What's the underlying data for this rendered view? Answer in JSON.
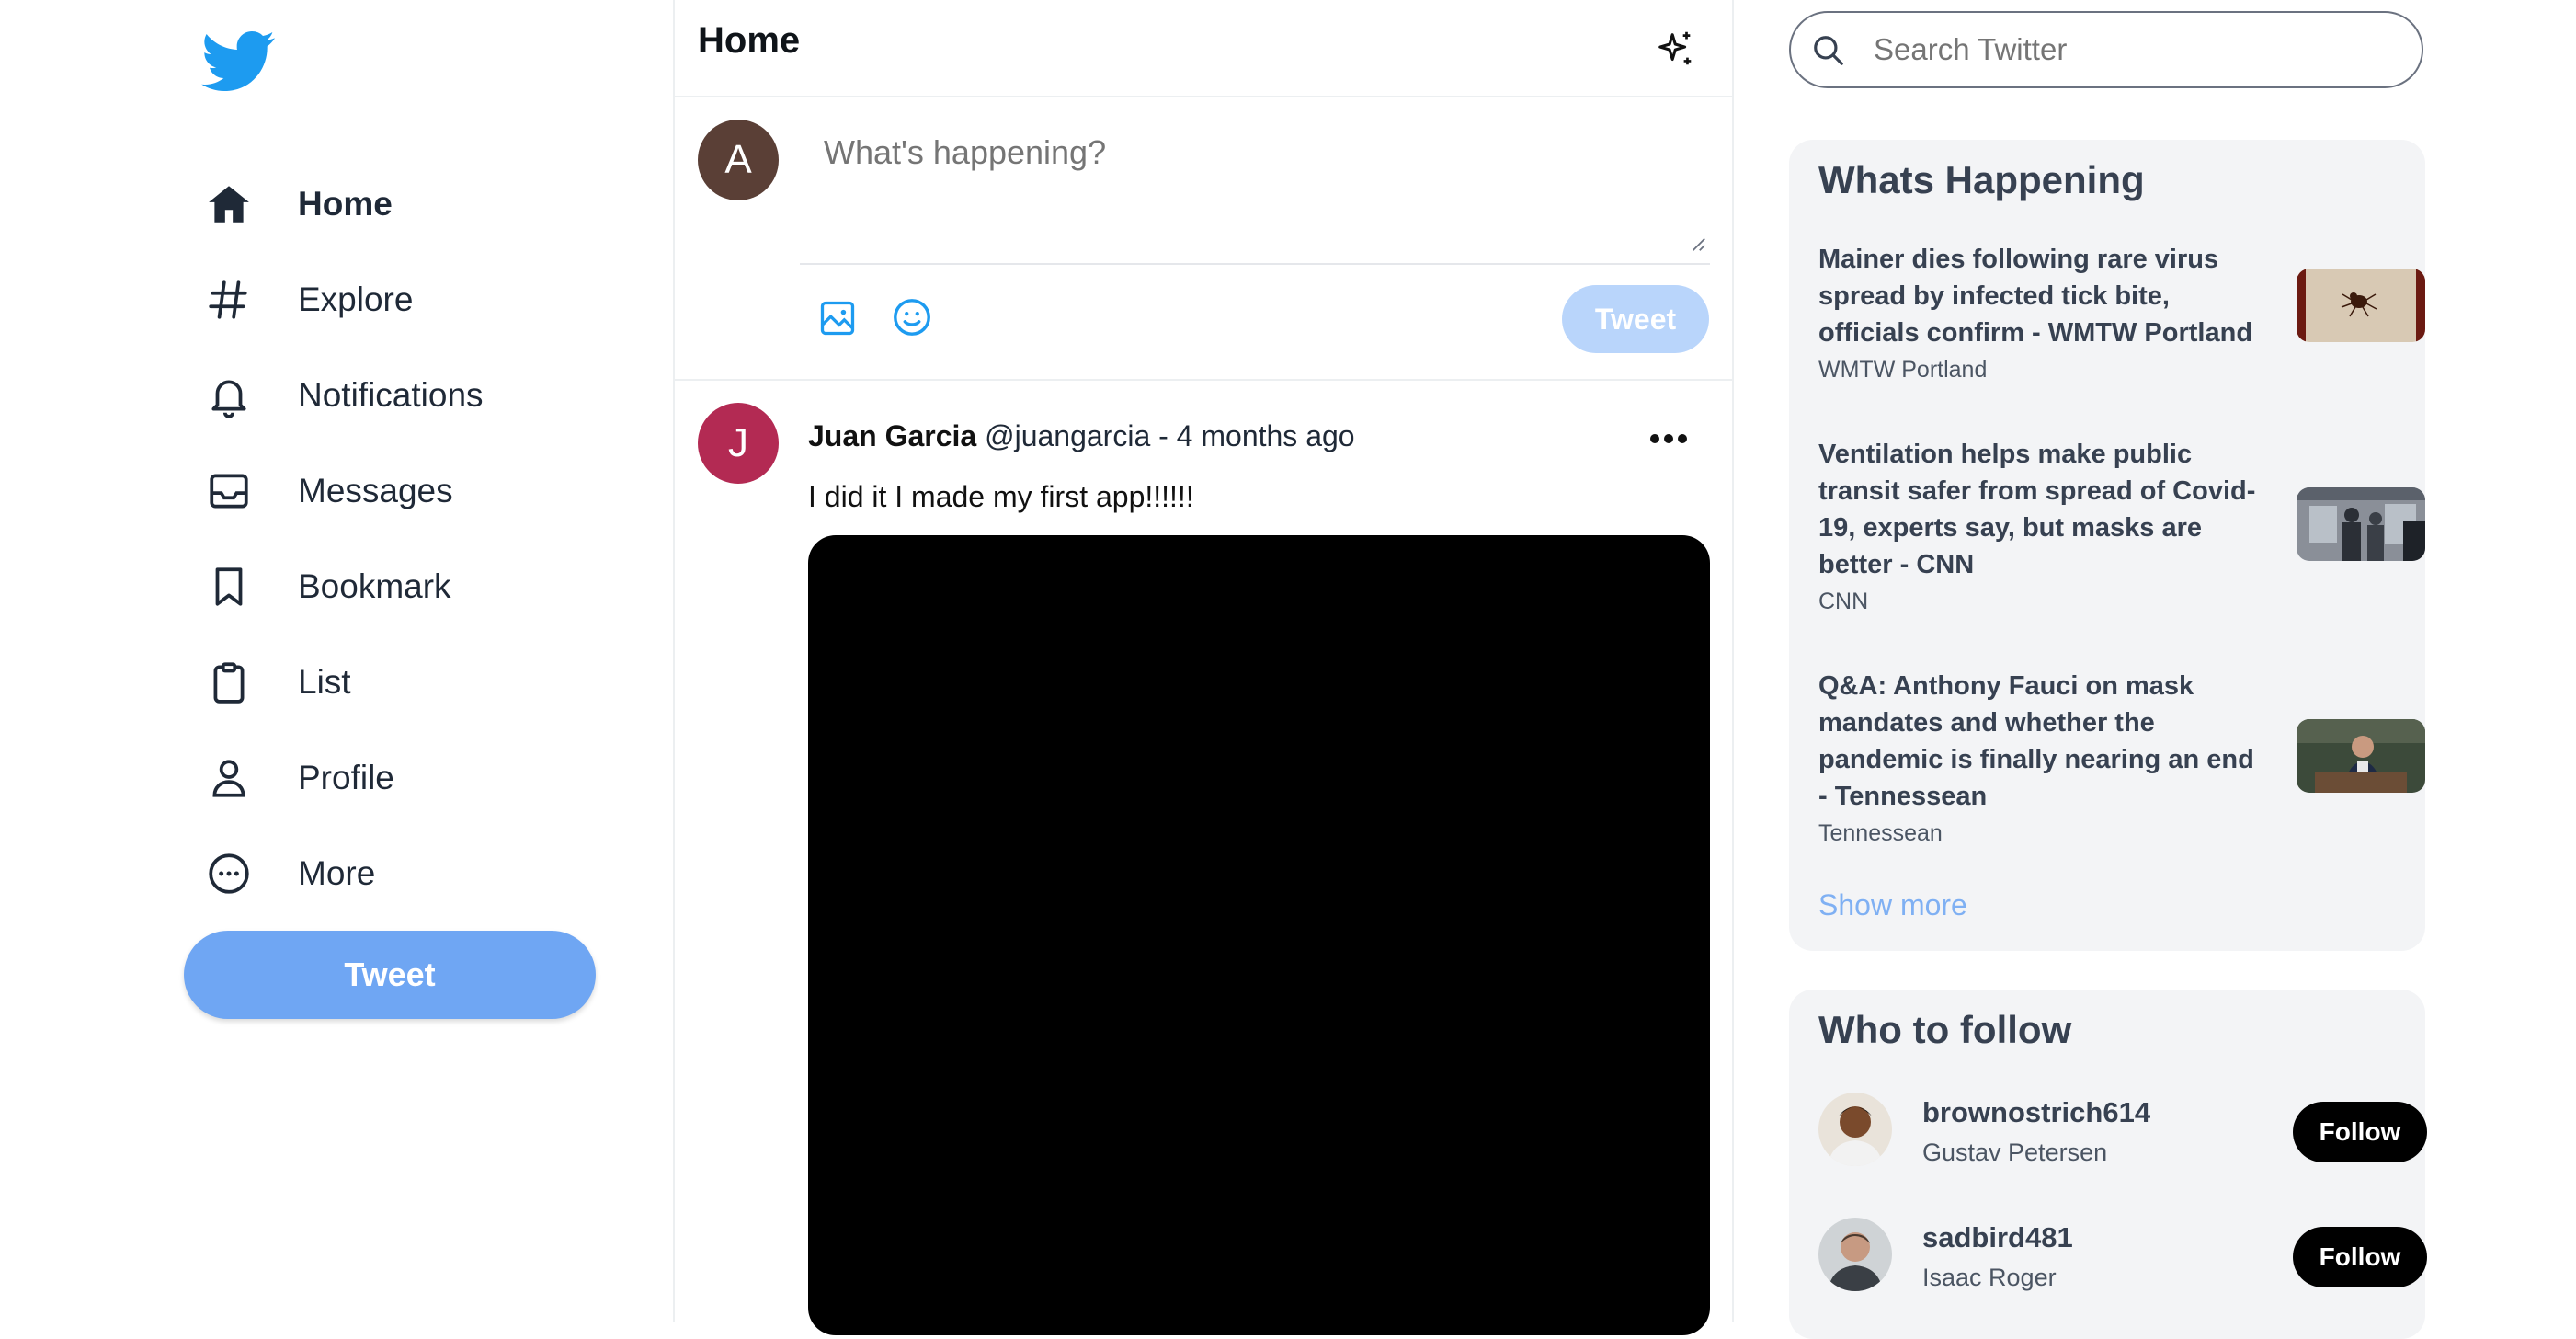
{
  "colors": {
    "brand": "#1d9bf0",
    "tweet_button": "#6fa6f3",
    "tweet_button_disabled": "#b9d5fb",
    "show_more": "#7fb0f3"
  },
  "sidebar": {
    "logo_icon": "twitter-bird-icon",
    "items": [
      {
        "label": "Home",
        "icon": "home-icon",
        "active": true
      },
      {
        "label": "Explore",
        "icon": "hashtag-icon"
      },
      {
        "label": "Notifications",
        "icon": "bell-icon"
      },
      {
        "label": "Messages",
        "icon": "inbox-icon"
      },
      {
        "label": "Bookmark",
        "icon": "bookmark-icon"
      },
      {
        "label": "List",
        "icon": "clipboard-icon"
      },
      {
        "label": "Profile",
        "icon": "user-icon"
      },
      {
        "label": "More",
        "icon": "more-circle-icon"
      }
    ],
    "tweet_button": "Tweet"
  },
  "header": {
    "title": "Home",
    "icon": "sparkle-icon"
  },
  "composer": {
    "avatar_letter": "A",
    "placeholder": "What's happening?",
    "tweet_button": "Tweet",
    "icons": [
      "image-icon",
      "emoji-icon"
    ]
  },
  "post": {
    "avatar_letter": "J",
    "name": "Juan Garcia",
    "handle": "@juangarcia",
    "separator": "-",
    "time": "4 months ago",
    "text": "I did it I made my first app!!!!!!"
  },
  "search": {
    "placeholder": "Search Twitter"
  },
  "happening": {
    "title": "Whats Happening",
    "items": [
      {
        "headline": "Mainer dies following rare virus spread by infected tick bite, officials confirm - WMTW Portland",
        "source": "WMTW Portland"
      },
      {
        "headline": "Ventilation helps make public transit safer from spread of Covid-19, experts say, but masks are better - CNN",
        "source": "CNN"
      },
      {
        "headline": "Q&A: Anthony Fauci on mask mandates and whether the pandemic is finally nearing an end - Tennessean",
        "source": "Tennessean"
      }
    ],
    "show_more": "Show more"
  },
  "who_to_follow": {
    "title": "Who to follow",
    "users": [
      {
        "username": "brownostrich614",
        "name": "Gustav Petersen",
        "button": "Follow"
      },
      {
        "username": "sadbird481",
        "name": "Isaac Roger",
        "button": "Follow"
      }
    ]
  }
}
